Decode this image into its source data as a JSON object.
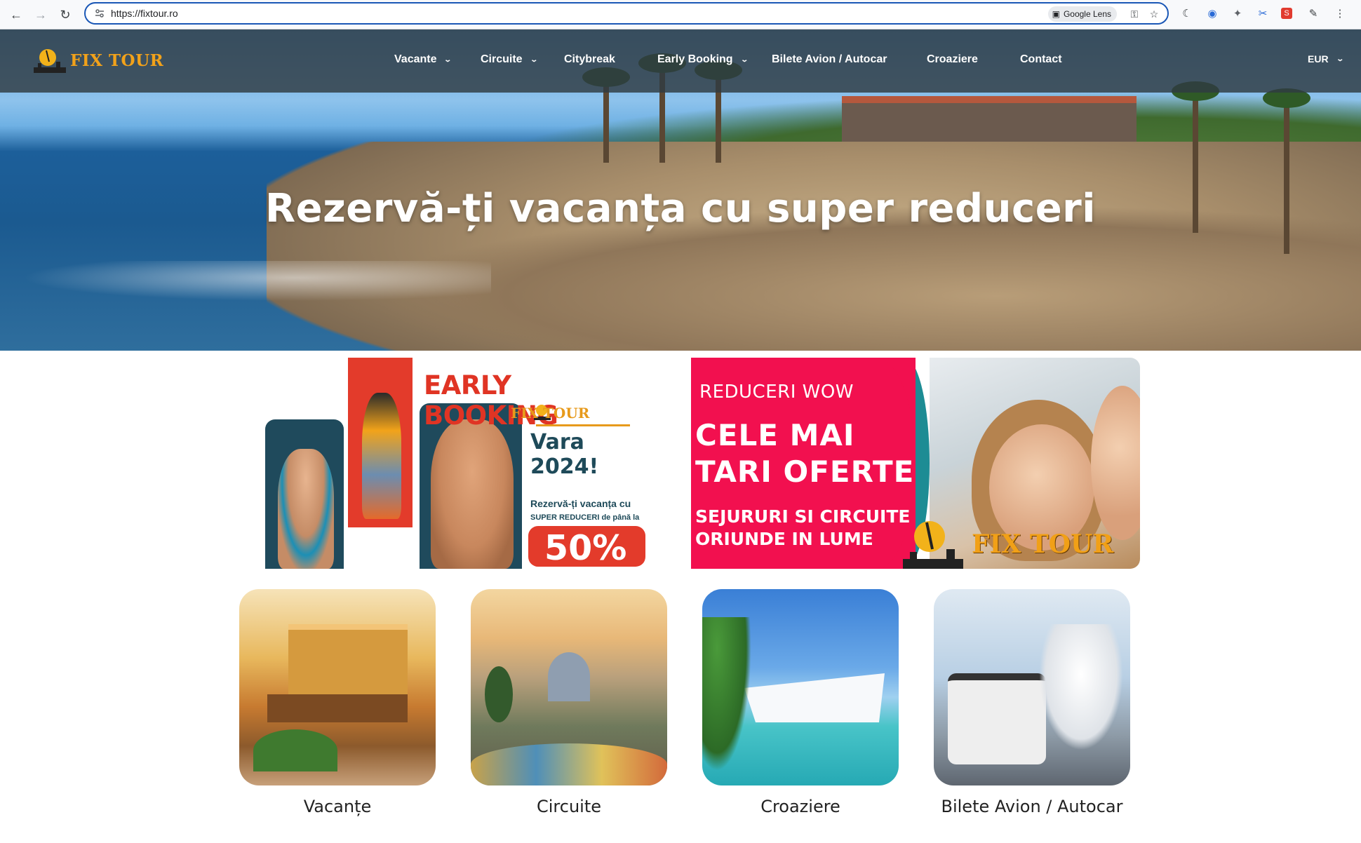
{
  "browser": {
    "url": "https://fixtour.ro",
    "lens_label": "Google Lens"
  },
  "site": {
    "logo_text": "FIX TOUR",
    "menu": [
      {
        "label": "Vacante",
        "has_dropdown": true
      },
      {
        "label": "Circuite",
        "has_dropdown": true
      },
      {
        "label": "Citybreak",
        "has_dropdown": false
      },
      {
        "label": "Early Booking",
        "has_dropdown": true
      },
      {
        "label": "Bilete Avion / Autocar",
        "has_dropdown": false
      },
      {
        "label": "Croaziere",
        "has_dropdown": false
      },
      {
        "label": "Contact",
        "has_dropdown": false
      }
    ],
    "currency": "EUR"
  },
  "hero": {
    "title": "Rezervă-ți vacanța cu super reduceri"
  },
  "banners": {
    "early_booking": {
      "title": "EARLY BOOKING",
      "brand": "FIX TOUR",
      "season": "Vara 2024!",
      "sub1": "Rezervă-ți vacanța cu",
      "sub2": "SUPER REDUCERI de până la",
      "discount": "50%"
    },
    "wow": {
      "kicker": "REDUCERI WOW",
      "line1": "CELE MAI",
      "line2": "TARI OFERTE",
      "line3": "SEJURURI SI CIRCUITE",
      "line4": "ORIUNDE IN LUME",
      "brand": "FIX TOUR"
    }
  },
  "categories": [
    {
      "label": "Vacanțe"
    },
    {
      "label": "Circuite"
    },
    {
      "label": "Croaziere"
    },
    {
      "label": "Bilete Avion / Autocar"
    }
  ]
}
